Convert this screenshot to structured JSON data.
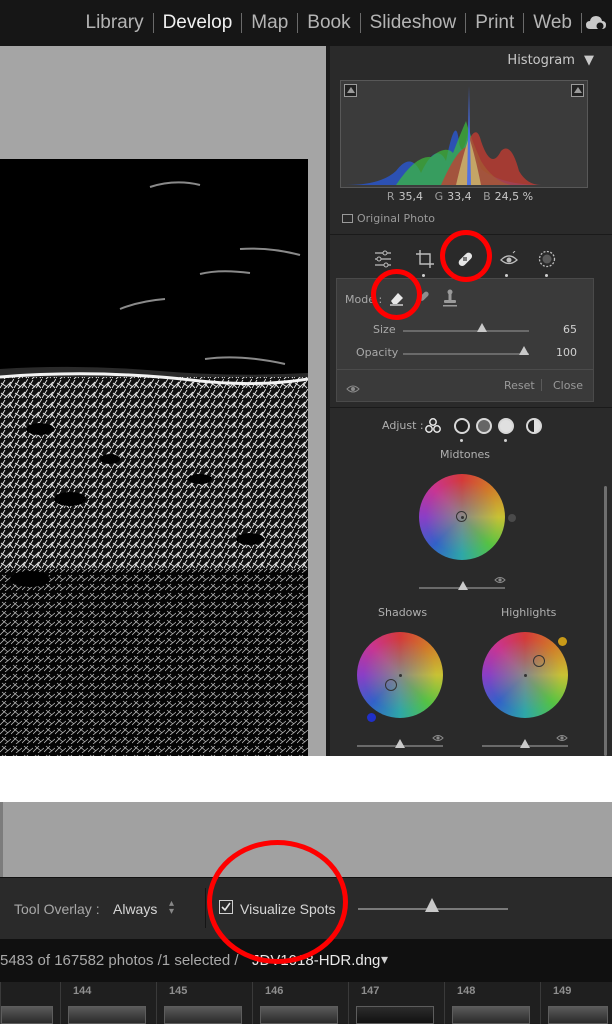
{
  "modules": [
    {
      "label": "Library",
      "active": false
    },
    {
      "label": "Develop",
      "active": true
    },
    {
      "label": "Map",
      "active": false
    },
    {
      "label": "Book",
      "active": false
    },
    {
      "label": "Slideshow",
      "active": false
    },
    {
      "label": "Print",
      "active": false
    },
    {
      "label": "Web",
      "active": false
    }
  ],
  "histogram": {
    "title": "Histogram",
    "title_arrow": "▼",
    "r_label": "R",
    "r_value": "35,4",
    "g_label": "G",
    "g_value": "33,4",
    "b_label": "B",
    "b_value": "24,5 %",
    "original_photo": "Original Photo"
  },
  "spot_panel": {
    "mode_label": "Mode :",
    "size_label": "Size",
    "size_value": "65",
    "opacity_label": "Opacity",
    "opacity_value": "100",
    "reset_label": "Reset",
    "close_label": "Close"
  },
  "color_grading": {
    "adjust_label": "Adjust :",
    "midtones_label": "Midtones",
    "shadows_label": "Shadows",
    "highlights_label": "Highlights"
  },
  "toolbar": {
    "tool_overlay_label": "Tool Overlay :",
    "tool_overlay_value": "Always",
    "visualize_spots_label": "Visualize Spots",
    "visualize_spots_checked": true
  },
  "filmstrip": {
    "photo_count_text": "5483 of 167582 photos /1 selected /",
    "filename": "JDV1018-HDR.dng",
    "filename_arrow": "▾",
    "frames": [
      "144",
      "145",
      "146",
      "147",
      "148",
      "149"
    ]
  },
  "colors": {
    "annotation_red": "#ff0000",
    "panel_bg": "#2a2a2a",
    "module_active": "#f1f1f1"
  }
}
